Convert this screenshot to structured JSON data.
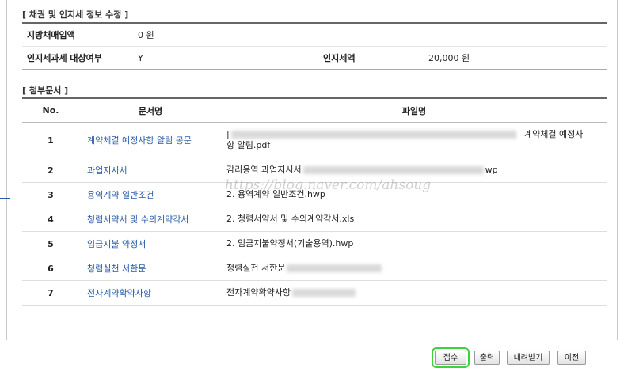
{
  "bond_section": {
    "title": "[ 채권 및 인지세 정보 수정 ]",
    "local_bond_label": "지방채매입액",
    "local_bond_value": "0 원",
    "stamp_tax_target_label": "인지세과세 대상여부",
    "stamp_tax_target_value": "Y",
    "stamp_tax_label": "인지세액",
    "stamp_tax_value": "20,000 원"
  },
  "attachments": {
    "title": "[ 첨부문서 ]",
    "headers": {
      "no": "No.",
      "doc": "문서명",
      "file": "파일명"
    },
    "rows": [
      {
        "no": "1",
        "doc": "계약체결 예정사항 알림 공문",
        "file_prefix": "",
        "file_suffix": "계약체결 예정사",
        "file_line2": "항 알림.pdf"
      },
      {
        "no": "2",
        "doc": "과업지시서",
        "file_prefix": "감리용역 과업지시서",
        "file_suffix": "wp"
      },
      {
        "no": "3",
        "doc": "용역계약 일반조건",
        "file_prefix": "2. 용역계약 일반조건.hwp",
        "file_suffix": ""
      },
      {
        "no": "4",
        "doc": "청렴서약서 및 수의계약각서",
        "file_prefix": "2. 청렴서약서 및 수의계약각서.xls",
        "file_suffix": ""
      },
      {
        "no": "5",
        "doc": "임금지불 약정서",
        "file_prefix": "2. 임금지불약정서(기술용역).hwp",
        "file_suffix": ""
      },
      {
        "no": "6",
        "doc": "청렴실천 서한문",
        "file_prefix": "청렴실천 서한문",
        "file_suffix": ""
      },
      {
        "no": "7",
        "doc": "전자계약확약사항",
        "file_prefix": "전자계약확약사항",
        "file_suffix": ""
      }
    ]
  },
  "watermark": "https://blog.naver.com/ahsoug",
  "buttons": {
    "receive": "접수",
    "print": "출력",
    "download": "내려받기",
    "prev": "이전"
  },
  "colors": {
    "link": "#2a5aa8",
    "highlight": "#3bd43b"
  }
}
